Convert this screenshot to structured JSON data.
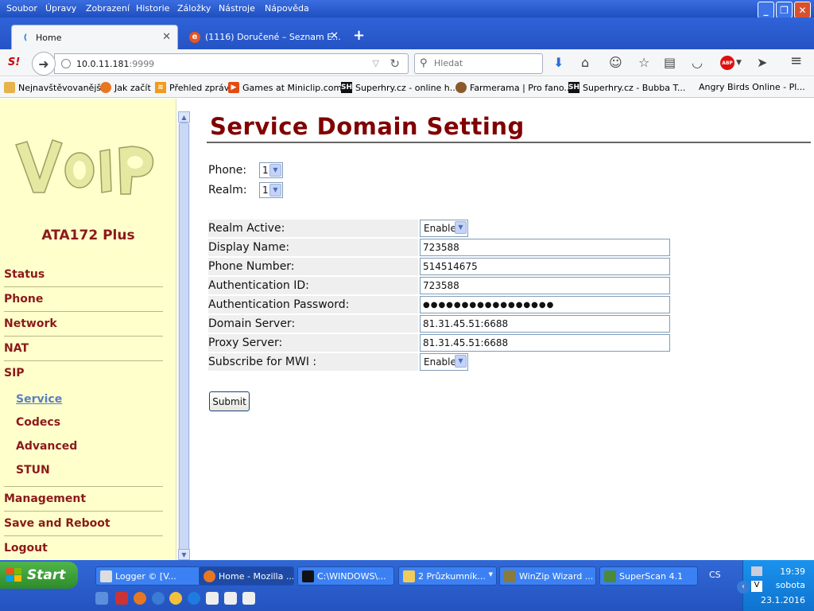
{
  "menubar": {
    "items": [
      "Soubor",
      "Úpravy",
      "Zobrazení",
      "Historie",
      "Záložky",
      "Nástroje",
      "Nápověda"
    ]
  },
  "tabs": [
    {
      "label": "Home"
    },
    {
      "label": "(1116) Doručené – Seznam E..."
    }
  ],
  "navbar": {
    "url_host": "10.0.11.181",
    "url_port": ":9999",
    "search_placeholder": "Hledat"
  },
  "bookmarks": [
    "Nejnavštěvovanější",
    "Jak začít",
    "Přehled zpráv",
    "Games at Miniclip.com ...",
    "Superhry.cz - online h...",
    "Farmerama | Pro fano...",
    "Superhry.cz - Bubba T...",
    "Angry Birds Online - Pl..."
  ],
  "sidebar": {
    "model": "ATA172 Plus",
    "items": [
      "Status",
      "Phone",
      "Network",
      "NAT",
      "SIP",
      "Management",
      "Save and Reboot",
      "Logout"
    ],
    "sip_sub": [
      "Service",
      "Codecs",
      "Advanced",
      "STUN"
    ]
  },
  "page": {
    "title": "Service Domain Setting",
    "phone_label": "Phone:",
    "phone_value": "1",
    "realm_label": "Realm:",
    "realm_value": "1",
    "rows": [
      {
        "label": "Realm Active:",
        "type": "select",
        "value": "Enable"
      },
      {
        "label": "Display Name:",
        "type": "text",
        "value": "723588"
      },
      {
        "label": "Phone Number:",
        "type": "text",
        "value": "514514675"
      },
      {
        "label": "Authentication ID:",
        "type": "text",
        "value": "723588"
      },
      {
        "label": "Authentication Password:",
        "type": "password",
        "value": "●●●●●●●●●●●●●●●●●"
      },
      {
        "label": "Domain Server:",
        "type": "text",
        "value": "81.31.45.51:6688"
      },
      {
        "label": "Proxy Server:",
        "type": "text",
        "value": "81.31.45.51:6688"
      },
      {
        "label": "Subscribe for MWI :",
        "type": "select",
        "value": "Enable"
      }
    ],
    "submit_label": "Submit"
  },
  "taskbar": {
    "start_label": "Start",
    "tasks": [
      "Logger © [V...",
      "Home - Mozilla ...",
      "C:\\WINDOWS\\...",
      "2 Průzkumník...",
      "WinZip Wizard ...",
      "SuperScan 4.1"
    ],
    "lang": "CS",
    "time": "19:39",
    "day": "sobota",
    "date": "23.1.2016"
  }
}
